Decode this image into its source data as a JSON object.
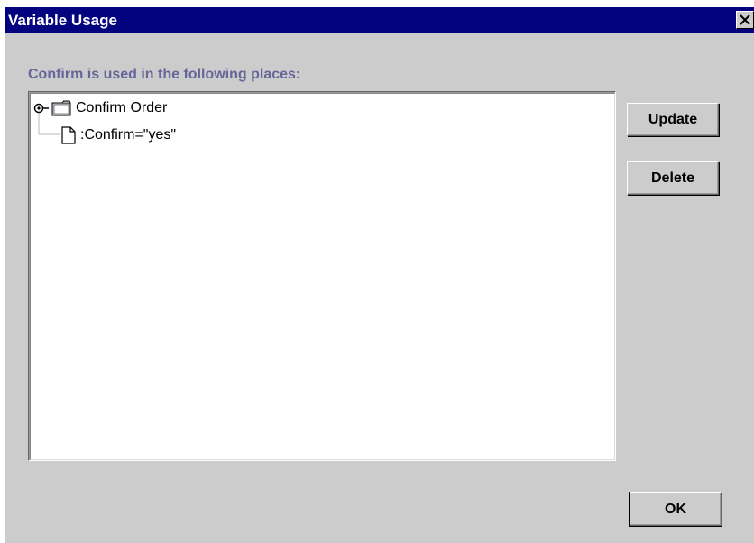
{
  "window": {
    "title": "Variable Usage",
    "close_icon": "close-x-icon"
  },
  "heading": "Confirm  is used in the following places:",
  "tree": {
    "root": {
      "label": "Confirm Order",
      "icon": "folder-icon",
      "expanded": true,
      "children": [
        {
          "label": ":Confirm=\"yes\"",
          "icon": "document-icon"
        }
      ]
    }
  },
  "buttons": {
    "update_label": "Update",
    "delete_label": "Delete",
    "ok_label": "OK"
  },
  "colors": {
    "titlebar": "#030380",
    "heading": "#666699",
    "background": "#cccccc"
  }
}
